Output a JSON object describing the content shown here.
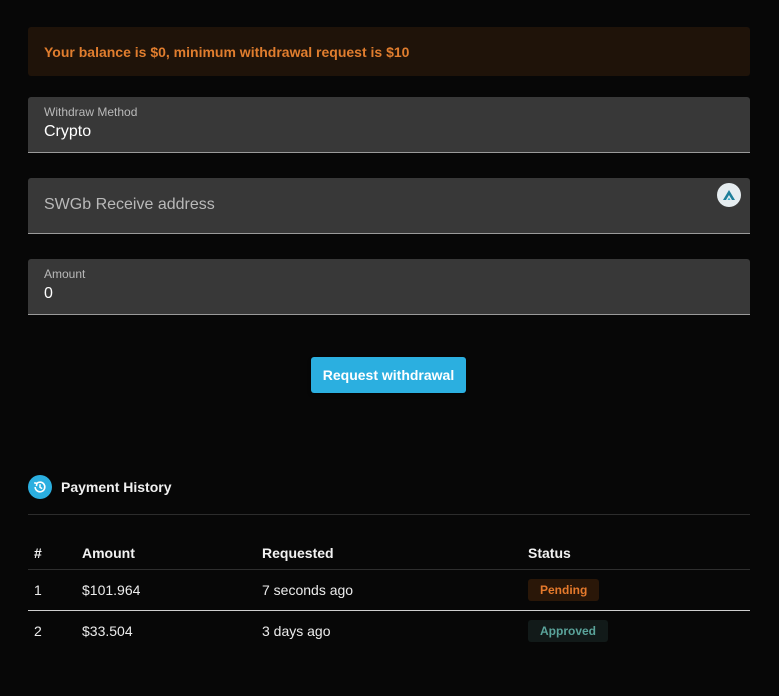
{
  "alert": {
    "text": "Your balance is $0, minimum withdrawal request is $10"
  },
  "form": {
    "method": {
      "label": "Withdraw Method",
      "value": "Crypto"
    },
    "address": {
      "placeholder": "SWGb Receive address",
      "icon": "wallet-logo-icon"
    },
    "amount": {
      "label": "Amount",
      "value": "0"
    },
    "submit_label": "Request withdrawal"
  },
  "history": {
    "title": "Payment History",
    "icon": "history-icon",
    "columns": [
      "#",
      "Amount",
      "Requested",
      "Status"
    ],
    "rows": [
      {
        "num": "1",
        "amount": "$101.964",
        "requested": "7 seconds ago",
        "status": "Pending"
      },
      {
        "num": "2",
        "amount": "$33.504",
        "requested": "3 days ago",
        "status": "Approved"
      }
    ]
  },
  "colors": {
    "accent": "#2bafe0",
    "warning": "#e07d2e",
    "approved": "#5aa39a",
    "background": "#070707"
  }
}
